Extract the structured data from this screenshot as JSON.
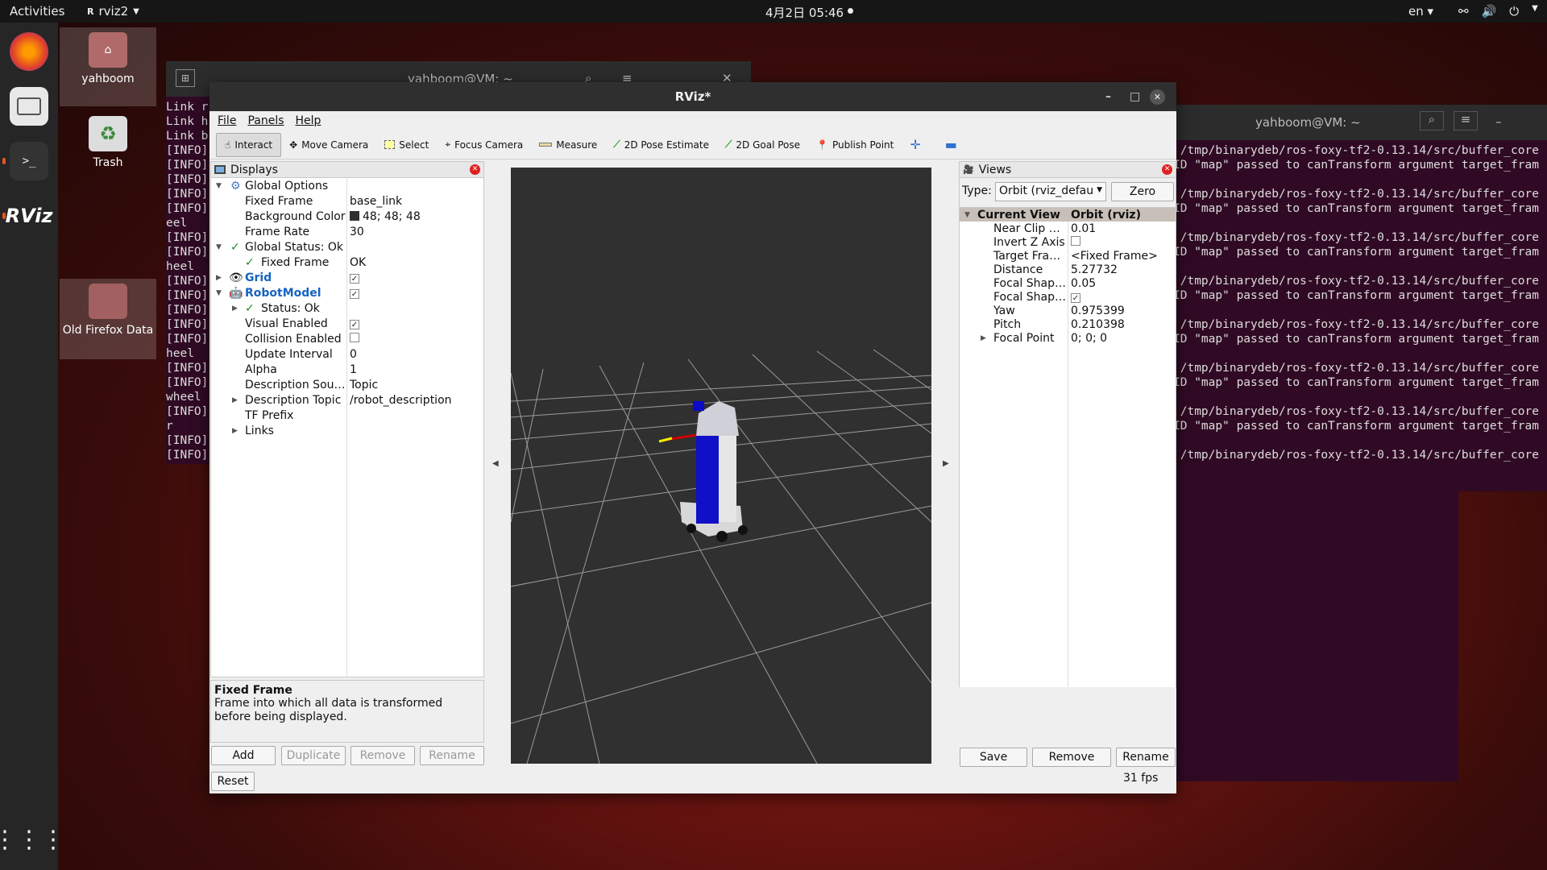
{
  "topbar": {
    "activities": "Activities",
    "app": "rviz2",
    "clock": "4月2日 05:46",
    "lang": "en"
  },
  "desktop": {
    "icons": [
      {
        "label": "yahboom"
      },
      {
        "label": "Trash"
      },
      {
        "label": "Old Firefox Data"
      }
    ]
  },
  "term_left": {
    "title": "yahboom@VM: ~",
    "lines": [
      "Link r",
      "Link h",
      "Link b",
      "[INFO]",
      "[INFO]",
      "[INFO]",
      "[INFO]",
      "[INFO]",
      "eel",
      "[INFO]",
      "[INFO]",
      "heel",
      "[INFO]",
      "[INFO]",
      "[INFO]",
      "[INFO]",
      "[INFO]",
      "heel",
      "[INFO]",
      "[INFO]",
      "wheel",
      "[INFO]",
      "r",
      "[INFO]",
      "[INFO]"
    ]
  },
  "term_right": {
    "title": "yahboom@VM: ~",
    "lines": [
      " /tmp/binarydeb/ros-foxy-tf2-0.13.14/src/buffer_core",
      "ID \"map\" passed to canTransform argument target_fram",
      "",
      " /tmp/binarydeb/ros-foxy-tf2-0.13.14/src/buffer_core",
      "ID \"map\" passed to canTransform argument target_fram",
      "",
      " /tmp/binarydeb/ros-foxy-tf2-0.13.14/src/buffer_core",
      "ID \"map\" passed to canTransform argument target_fram",
      "",
      " /tmp/binarydeb/ros-foxy-tf2-0.13.14/src/buffer_core",
      "ID \"map\" passed to canTransform argument target_fram",
      "",
      " /tmp/binarydeb/ros-foxy-tf2-0.13.14/src/buffer_core",
      "ID \"map\" passed to canTransform argument target_fram",
      "",
      " /tmp/binarydeb/ros-foxy-tf2-0.13.14/src/buffer_core",
      "ID \"map\" passed to canTransform argument target_fram",
      "",
      " /tmp/binarydeb/ros-foxy-tf2-0.13.14/src/buffer_core",
      "ID \"map\" passed to canTransform argument target_fram",
      "",
      " /tmp/binarydeb/ros-foxy-tf2-0.13.14/src/buffer_core"
    ]
  },
  "rviz": {
    "title": "RViz*",
    "menu": {
      "file": "File",
      "panels": "Panels",
      "help": "Help"
    },
    "tools": {
      "interact": "Interact",
      "move_camera": "Move Camera",
      "select": "Select",
      "focus_camera": "Focus Camera",
      "measure": "Measure",
      "pose_estimate": "2D Pose Estimate",
      "goal_pose": "2D Goal Pose",
      "publish_point": "Publish Point"
    },
    "displays": {
      "title": "Displays",
      "global_options": "Global Options",
      "fixed_frame_k": "Fixed Frame",
      "fixed_frame_v": "base_link",
      "bg_color_k": "Background Color",
      "bg_color_v": "48; 48; 48",
      "frame_rate_k": "Frame Rate",
      "frame_rate_v": "30",
      "global_status": "Global Status: Ok",
      "gs_fixed_frame_k": "Fixed Frame",
      "gs_fixed_frame_v": "OK",
      "grid": "Grid",
      "robot_model": "RobotModel",
      "status_ok": "Status: Ok",
      "visual_enabled": "Visual Enabled",
      "collision_enabled": "Collision Enabled",
      "update_interval_k": "Update Interval",
      "update_interval_v": "0",
      "alpha_k": "Alpha",
      "alpha_v": "1",
      "desc_source_k": "Description Sou…",
      "desc_source_v": "Topic",
      "desc_topic_k": "Description Topic",
      "desc_topic_v": "/robot_description",
      "tf_prefix": "TF Prefix",
      "links": "Links",
      "help_title": "Fixed Frame",
      "help_text": "Frame into which all data is transformed before being displayed.",
      "add": "Add",
      "duplicate": "Duplicate",
      "remove": "Remove",
      "rename": "Rename",
      "reset": "Reset"
    },
    "views": {
      "title": "Views",
      "type_label": "Type:",
      "type_value": "Orbit (rviz_defau",
      "zero": "Zero",
      "current_view": "Current View",
      "current_view_v": "Orbit (rviz)",
      "props": [
        {
          "k": "Near Clip …",
          "v": "0.01"
        },
        {
          "k": "Invert Z Axis",
          "v": ""
        },
        {
          "k": "Target Fra…",
          "v": "<Fixed Frame>"
        },
        {
          "k": "Distance",
          "v": "5.27732"
        },
        {
          "k": "Focal Shap…",
          "v": "0.05"
        },
        {
          "k": "Focal Shap…",
          "v": ""
        },
        {
          "k": "Yaw",
          "v": "0.975399"
        },
        {
          "k": "Pitch",
          "v": "0.210398"
        },
        {
          "k": "Focal Point",
          "v": "0; 0; 0"
        }
      ],
      "save": "Save",
      "remove": "Remove",
      "rename": "Rename",
      "fps": "31 fps"
    }
  }
}
